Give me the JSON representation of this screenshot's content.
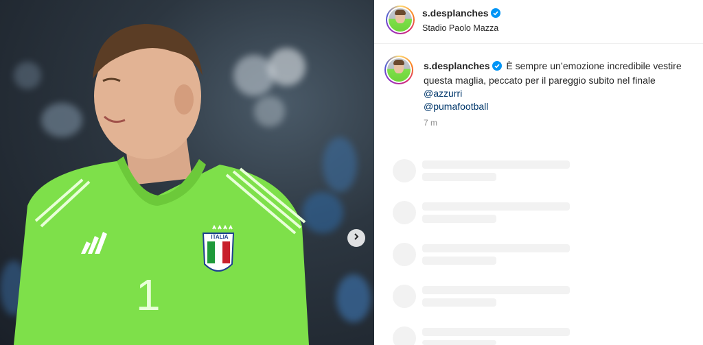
{
  "post": {
    "username": "s.desplanches",
    "location": "Stadio Paolo Mazza",
    "caption_line1": "È sempre un’emozione incredibile vestire",
    "caption_line2": "questa maglia, peccato per il pareggio subito nel finale",
    "mention1": "@azzurri",
    "mention2": "@pumafootball",
    "time_ago": "7 m"
  },
  "photo": {
    "jersey_text": "ITALIA",
    "jersey_number": "1"
  },
  "colors": {
    "verified": "#0095f6",
    "mention": "#00376b",
    "jersey": "#7ee04a",
    "skeleton": "#f2f2f2"
  }
}
